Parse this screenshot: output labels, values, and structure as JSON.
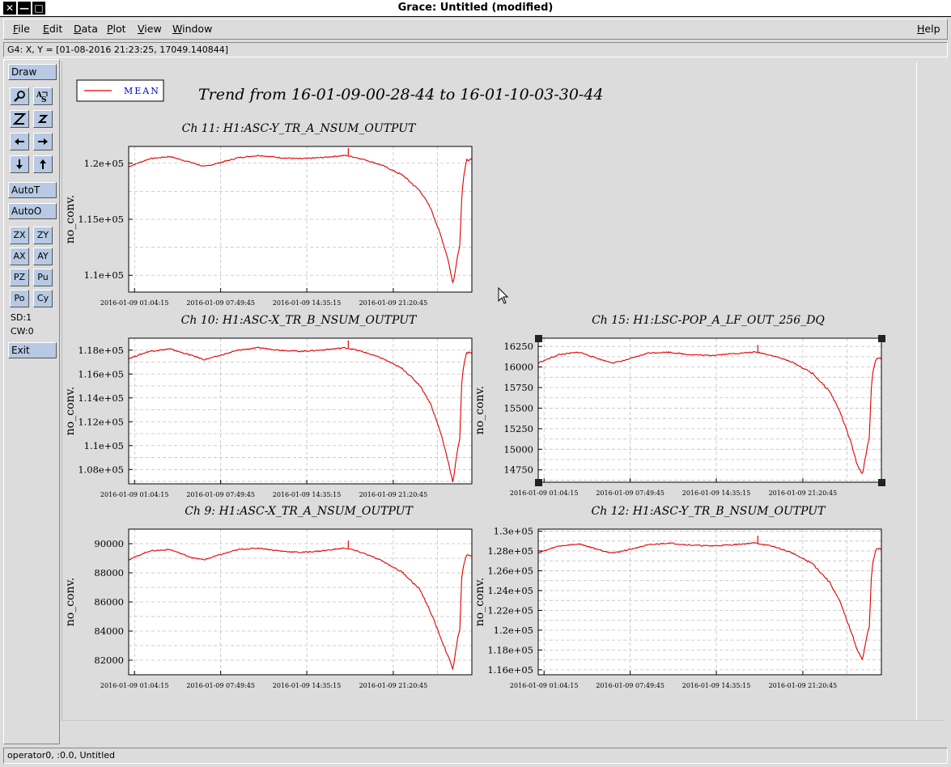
{
  "window": {
    "title": "Grace: Untitled (modified)",
    "close_glyph": "✕",
    "minimize_glyph": "—",
    "maximize_glyph": "□"
  },
  "menu": {
    "file": "File",
    "edit": "Edit",
    "data": "Data",
    "plot": "Plot",
    "view": "View",
    "window": "Window",
    "help": "Help"
  },
  "locator": {
    "text": "G4: X, Y = [01-08-2016 21:23:25, 17049.140844]"
  },
  "toolbar": {
    "draw": "Draw",
    "autot": "AutoT",
    "autoo": "AutoO",
    "zx": "ZX",
    "zy": "ZY",
    "ax": "AX",
    "ay": "AY",
    "pz": "PZ",
    "pu": "Pu",
    "po": "Po",
    "cy": "Cy",
    "sd": "SD:1",
    "cw": "CW:0",
    "exit": "Exit",
    "icons": [
      "zoom-icon",
      "autoscale-text-icon",
      "zoom-x-icon",
      "zoom-y-icon",
      "arrow-left-icon",
      "arrow-right-icon",
      "arrow-down-icon",
      "arrow-up-icon"
    ]
  },
  "status": {
    "text": "operator0, :0.0, Untitled"
  },
  "colors": {
    "series": "#e00000",
    "legend_text": "#0000cc",
    "plot_bg": "#ffffff",
    "grid": "#c0c0c0"
  },
  "chart_data": {
    "main_title": "Trend from 16-01-09-00-28-44 to 16-01-10-03-30-44",
    "legend": {
      "label": "MEAN",
      "position": "top-left"
    },
    "x_tick_labels": [
      "2016-01-09 01:04:15",
      "2016-01-09 07:49:45",
      "2016-01-09 14:35:15",
      "2016-01-09 21:20:45"
    ],
    "x_range": [
      "2016-01-09 00:28:44",
      "2016-01-10 03:30:44"
    ],
    "grid": true,
    "charts": [
      {
        "type": "line",
        "title": "Ch 11: H1:ASC-Y_TR_A_NSUM_OUTPUT",
        "ylabel": "no_conv.",
        "ylim": [
          108500,
          121500
        ],
        "yticks": [
          110000,
          115000,
          120000
        ],
        "yticklabels": [
          "1.1e+05",
          "1.15e+05",
          "1.2e+05"
        ],
        "series": [
          {
            "name": "MEAN",
            "x": [
              0.0,
              0.06,
              0.12,
              0.19,
              0.22,
              0.26,
              0.32,
              0.38,
              0.44,
              0.5,
              0.56,
              0.63,
              0.65,
              0.69,
              0.74,
              0.8,
              0.85,
              0.88,
              0.91,
              0.93,
              0.945,
              0.96,
              0.965,
              0.97,
              0.975,
              0.985,
              1.0
            ],
            "y": [
              119700,
              120400,
              120600,
              120000,
              119700,
              120000,
              120500,
              120700,
              120500,
              120400,
              120500,
              120700,
              120600,
              120300,
              119800,
              118900,
              117500,
              116000,
              113500,
              111500,
              109200,
              112000,
              112700,
              116700,
              118600,
              120300,
              120300
            ]
          }
        ]
      },
      {
        "type": "line",
        "title": "Ch 10: H1:ASC-X_TR_B_NSUM_OUTPUT",
        "ylabel": "no_conv.",
        "ylim": [
          106800,
          119000
        ],
        "yticks": [
          108000,
          110000,
          112000,
          114000,
          116000,
          118000
        ],
        "yticklabels": [
          "1.08e+05",
          "1.1e+05",
          "1.12e+05",
          "1.14e+05",
          "1.16e+05",
          "1.18e+05"
        ],
        "series": [
          {
            "name": "MEAN",
            "x": [
              0.0,
              0.06,
              0.12,
              0.19,
              0.22,
              0.26,
              0.32,
              0.38,
              0.44,
              0.5,
              0.56,
              0.63,
              0.65,
              0.69,
              0.74,
              0.8,
              0.85,
              0.88,
              0.91,
              0.93,
              0.945,
              0.96,
              0.965,
              0.97,
              0.975,
              0.985,
              1.0
            ],
            "y": [
              117300,
              117900,
              118100,
              117500,
              117200,
              117500,
              118000,
              118200,
              118000,
              117900,
              118000,
              118200,
              118100,
              117800,
              117300,
              116400,
              115000,
              113500,
              111000,
              108800,
              106900,
              110000,
              110600,
              115000,
              116500,
              117800,
              117800
            ]
          }
        ]
      },
      {
        "type": "line",
        "title": "Ch 15: H1:LSC-POP_A_LF_OUT_256_DQ",
        "ylabel": "no_conv.",
        "ylim": [
          14600,
          16350
        ],
        "yticks": [
          14750,
          15000,
          15250,
          15500,
          15750,
          16000,
          16250
        ],
        "yticklabels": [
          "14750",
          "15000",
          "15250",
          "15500",
          "15750",
          "16000",
          "16250"
        ],
        "series": [
          {
            "name": "MEAN",
            "x": [
              0.0,
              0.06,
              0.12,
              0.19,
              0.22,
              0.26,
              0.32,
              0.38,
              0.44,
              0.5,
              0.56,
              0.63,
              0.65,
              0.69,
              0.74,
              0.8,
              0.85,
              0.88,
              0.91,
              0.93,
              0.945,
              0.96,
              0.965,
              0.97,
              0.975,
              0.985,
              1.0
            ],
            "y": [
              16050,
              16150,
              16180,
              16080,
              16050,
              16090,
              16170,
              16180,
              16150,
              16140,
              16160,
              16180,
              16170,
              16130,
              16060,
              15920,
              15700,
              15450,
              15100,
              14800,
              14700,
              15050,
              15150,
              15700,
              15950,
              16100,
              16100
            ]
          }
        ]
      },
      {
        "type": "line",
        "title": "Ch 9: H1:ASC-X_TR_A_NSUM_OUTPUT",
        "ylabel": "no_conv.",
        "ylim": [
          81000,
          91000
        ],
        "yticks": [
          82000,
          84000,
          86000,
          88000,
          90000
        ],
        "yticklabels": [
          "82000",
          "84000",
          "86000",
          "88000",
          "90000"
        ],
        "series": [
          {
            "name": "MEAN",
            "x": [
              0.0,
              0.06,
              0.12,
              0.19,
              0.22,
              0.26,
              0.32,
              0.38,
              0.44,
              0.5,
              0.56,
              0.63,
              0.65,
              0.69,
              0.74,
              0.8,
              0.85,
              0.88,
              0.91,
              0.93,
              0.945,
              0.96,
              0.965,
              0.97,
              0.975,
              0.985,
              1.0
            ],
            "y": [
              88900,
              89500,
              89600,
              89000,
              88900,
              89200,
              89600,
              89700,
              89500,
              89400,
              89500,
              89700,
              89600,
              89300,
              88800,
              88000,
              86800,
              85300,
              83500,
              82300,
              81400,
              83700,
              84000,
              87500,
              88500,
              89200,
              89200
            ]
          }
        ]
      },
      {
        "type": "line",
        "title": "Ch 12: H1:ASC-Y_TR_B_NSUM_OUTPUT",
        "ylabel": "no_conv.",
        "ylim": [
          115500,
          130200
        ],
        "yticks": [
          116000,
          118000,
          120000,
          122000,
          124000,
          126000,
          128000,
          130000
        ],
        "yticklabels": [
          "1.16e+05",
          "1.18e+05",
          "1.2e+05",
          "1.22e+05",
          "1.24e+05",
          "1.26e+05",
          "1.28e+05",
          "1.3e+05"
        ],
        "series": [
          {
            "name": "MEAN",
            "x": [
              0.0,
              0.06,
              0.12,
              0.19,
              0.22,
              0.26,
              0.32,
              0.38,
              0.44,
              0.5,
              0.56,
              0.63,
              0.65,
              0.69,
              0.74,
              0.8,
              0.85,
              0.88,
              0.91,
              0.93,
              0.945,
              0.96,
              0.965,
              0.97,
              0.975,
              0.985,
              1.0
            ],
            "y": [
              127800,
              128500,
              128700,
              128000,
              127800,
              128100,
              128600,
              128800,
              128600,
              128500,
              128600,
              128800,
              128700,
              128400,
              127800,
              126700,
              124800,
              122800,
              120000,
              118000,
              117000,
              119800,
              120300,
              125000,
              126800,
              128200,
              128200
            ]
          }
        ]
      }
    ]
  }
}
